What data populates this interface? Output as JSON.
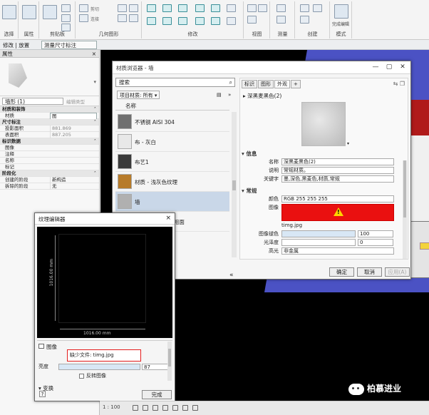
{
  "ribbon": {
    "groups": [
      {
        "label": "选择"
      },
      {
        "label": "属性"
      },
      {
        "label": "剪贴板"
      },
      {
        "label": "几何图形"
      },
      {
        "label": "修改"
      },
      {
        "label": "视图"
      },
      {
        "label": "测量"
      },
      {
        "label": "创建"
      },
      {
        "label": "模式"
      }
    ],
    "cut_label": "剪切",
    "join_label": "连接",
    "modify_label": "修改",
    "paste_label": "粘贴",
    "finish_label": "完成编辑"
  },
  "context_bar": {
    "breadcrumb": "修改 | 放置",
    "active_tab": "测量尺寸标注"
  },
  "properties": {
    "title": "属性",
    "close": "×",
    "type_selector": "墙形 (1)",
    "edit_type": "编辑类型",
    "rows": [
      {
        "section": true,
        "key": "材质和装饰",
        "value": ""
      },
      {
        "key": "材质",
        "value": "图",
        "style": "box"
      },
      {
        "section": true,
        "key": "尺寸标注",
        "value": ""
      },
      {
        "key": "投影面积",
        "value": "881.869",
        "style": "gray"
      },
      {
        "key": "表面积",
        "value": "887.205",
        "style": "gray"
      },
      {
        "section": true,
        "key": "标识数据",
        "value": ""
      },
      {
        "key": "图像",
        "value": ""
      },
      {
        "key": "注释",
        "value": ""
      },
      {
        "key": "名称",
        "value": ""
      },
      {
        "key": "标记",
        "value": ""
      },
      {
        "section": true,
        "key": "阶段化",
        "value": ""
      },
      {
        "key": "创建的阶段",
        "value": "新构造"
      },
      {
        "key": "拆除的阶段",
        "value": "无"
      }
    ]
  },
  "material_browser": {
    "title": "材质浏览器 - 墙",
    "search_placeholder": "搜索",
    "project_label": "项目材质: 所有",
    "column_name": "名称",
    "items": [
      {
        "name": "不锈钢 AISI 304",
        "swatch": "#6f6f6f",
        "selected": false
      },
      {
        "name": "布 - 灰白",
        "swatch": "#e8e8e8",
        "selected": false
      },
      {
        "name": "布艺1",
        "swatch": "#3a3a3a",
        "selected": false
      },
      {
        "name": "材质 - 浅灰色纹理",
        "swatch": "#b77b2a",
        "selected": false
      },
      {
        "name": "墙",
        "swatch": "#b0b0b0",
        "selected": true
      },
      {
        "name": "层压板 - 象牙白,粗面",
        "swatch": "#2b2b2b",
        "selected": false
      }
    ],
    "tabs": [
      {
        "label": "标识",
        "active": false
      },
      {
        "label": "图形",
        "active": false
      },
      {
        "label": "外观",
        "active": true
      }
    ],
    "asset_name": "深黑麦黑色(2)",
    "info_section": "信息",
    "info_rows": [
      {
        "label": "名称",
        "value": "深黑麦黑色(2)"
      },
      {
        "label": "说明",
        "value": "常规材质。"
      },
      {
        "label": "关键字",
        "value": "墨,深色,黑麦色,材质,常规"
      }
    ],
    "generic_section": "常规",
    "color_label": "颜色",
    "color_value": "RGB 255 255 255",
    "image_label": "图像",
    "image_file": "timg.jpg",
    "fade_label": "图像褪色",
    "fade_value": "100",
    "gloss_label": "光泽度",
    "gloss_value": "0",
    "highlight_label": "高光",
    "highlight_value": "非金属",
    "ok": "确定",
    "cancel": "取消",
    "apply": "应用(A)"
  },
  "texture_editor": {
    "title": "纹理编辑器",
    "close": "×",
    "height_dim": "1016.00 mm",
    "width_dim": "1016.00 mm",
    "image_section": "图像",
    "missing_file": "缺少文件: timg.jpg",
    "brightness_label": "亮度",
    "brightness_value": "87",
    "invert_label": "反转图像",
    "transform_section": "变换",
    "help": "?",
    "done": "完成"
  },
  "status_bar": {
    "scale": "1 : 100"
  },
  "watermark": "柏慕进业",
  "colors": {
    "ribbon_bg": "#f4f4f4",
    "selected_row": "#c9d7e8",
    "missing_border": "#e31d1d",
    "image_missing_bg": "#ea1010",
    "warning_yellow": "#ffd400",
    "viewport_bg": "#000000",
    "ground_blue": "#4b52c4"
  }
}
